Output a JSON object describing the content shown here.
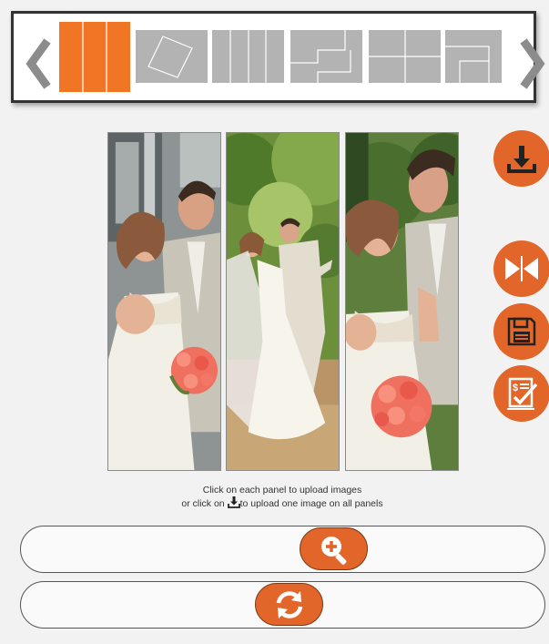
{
  "colors": {
    "accent": "#f07524",
    "button": "#e2662a",
    "template_inactive": "#b3b3b3",
    "background": "#f2f2f2"
  },
  "template_bar": {
    "prev_icon": "chevron-left-icon",
    "next_icon": "chevron-right-icon",
    "templates": [
      {
        "id": "three-vertical-strips",
        "selected": true
      },
      {
        "id": "tilted-frame",
        "selected": false
      },
      {
        "id": "four-vertical-strips",
        "selected": false
      },
      {
        "id": "interlocked-panels",
        "selected": false
      },
      {
        "id": "four-grid",
        "selected": false
      },
      {
        "id": "nested-frames",
        "selected": false
      }
    ]
  },
  "panels": [
    {
      "id": "panel-left",
      "content": "wedding couple photo"
    },
    {
      "id": "panel-middle",
      "content": "wedding couple kissing photo"
    },
    {
      "id": "panel-right",
      "content": "wedding couple close photo"
    }
  ],
  "side_tools": [
    {
      "id": "download",
      "icon": "download-icon"
    },
    {
      "id": "flip",
      "icon": "flip-horizontal-icon"
    },
    {
      "id": "save",
      "icon": "floppy-disk-icon"
    },
    {
      "id": "order",
      "icon": "price-order-icon"
    }
  ],
  "hint": {
    "line1": "Click on each panel to upload images",
    "line2_before": "or click on",
    "line2_after": "to upload one image on all panels"
  },
  "controls": {
    "zoom_icon": "zoom-in-icon",
    "reset_icon": "refresh-icon"
  }
}
